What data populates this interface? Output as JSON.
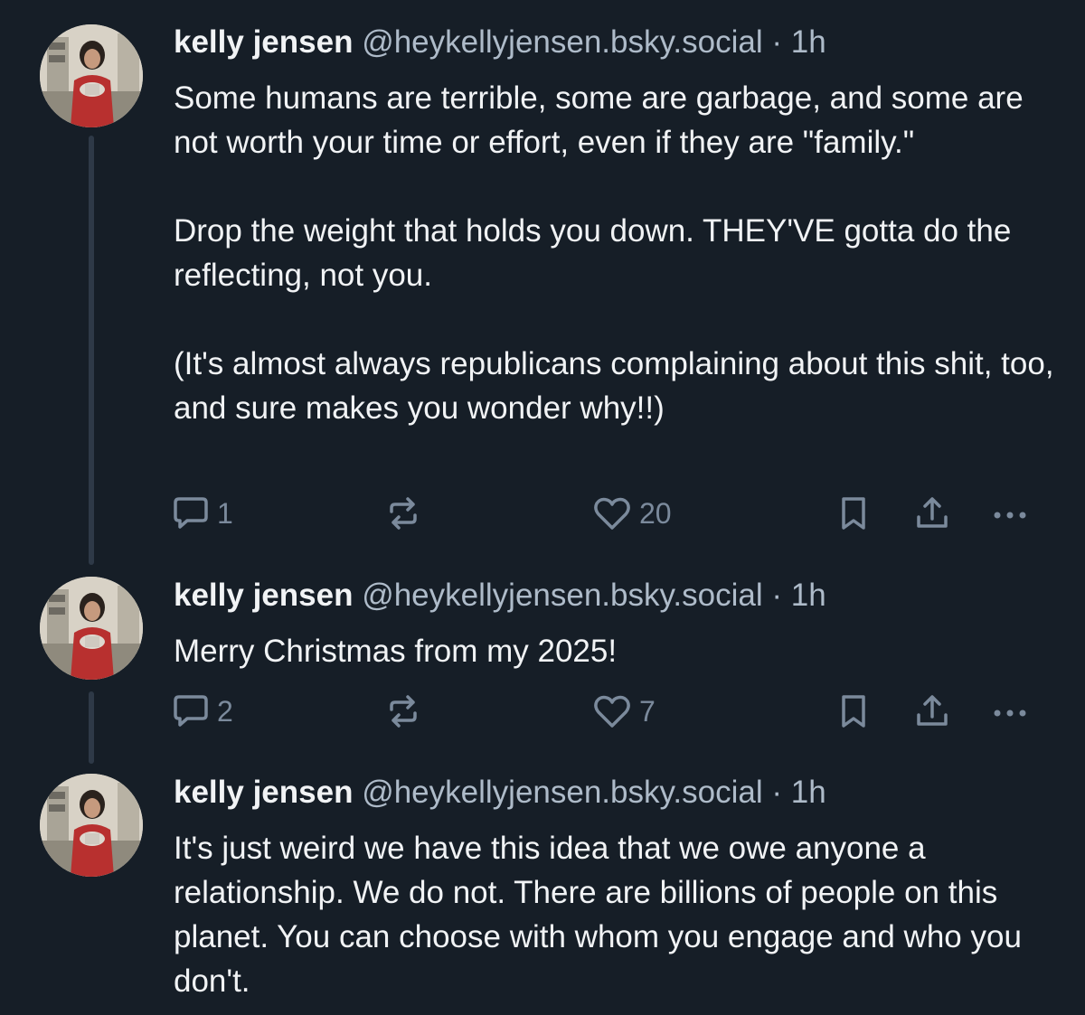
{
  "posts": [
    {
      "author": "kelly jensen",
      "handle": "@heykellyjensen.bsky.social",
      "separator": "·",
      "time": "1h",
      "text": "Some humans are terrible, some are garbage, and some are not worth your time or effort, even if they are \"family.\"\n\nDrop the weight that holds you down. THEY'VE gotta do the reflecting, not you.\n\n(It's almost always republicans complaining about this shit, too, and sure makes you wonder why!!)",
      "reply_count": "1",
      "like_count": "20"
    },
    {
      "author": "kelly jensen",
      "handle": "@heykellyjensen.bsky.social",
      "separator": "·",
      "time": "1h",
      "text": "Merry Christmas from my 2025!",
      "reply_count": "2",
      "like_count": "7"
    },
    {
      "author": "kelly jensen",
      "handle": "@heykellyjensen.bsky.social",
      "separator": "·",
      "time": "1h",
      "text": "It's just weird we have this idea that we owe anyone a relationship. We do not. There are billions of people on this planet. You can choose with whom you engage and who you don't."
    }
  ],
  "icons": {
    "reply": "speech-bubble-icon",
    "repost": "repost-arrows-icon",
    "like": "heart-icon",
    "bookmark": "bookmark-icon",
    "share": "share-upload-icon",
    "more": "ellipsis-icon"
  },
  "colors": {
    "background": "#161e27",
    "text": "#f1f3f5",
    "muted": "#aebbc9",
    "action": "#7b8a9c",
    "thread_line": "#2e3947"
  }
}
